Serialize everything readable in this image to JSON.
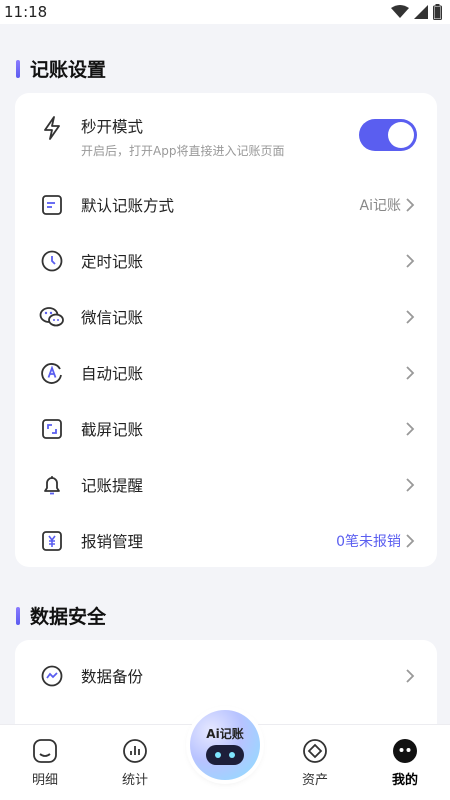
{
  "status": {
    "time": "11:18"
  },
  "sections": {
    "bookkeeping_title": "记账设置",
    "data_security_title": "数据安全"
  },
  "settings": {
    "quick_open": {
      "label": "秒开模式",
      "subtitle": "开启后，打开App将直接进入记账页面",
      "enabled": true
    },
    "default_method": {
      "label": "默认记账方式",
      "value": "Ai记账"
    },
    "scheduled": {
      "label": "定时记账"
    },
    "wechat": {
      "label": "微信记账"
    },
    "auto": {
      "label": "自动记账"
    },
    "screenshot": {
      "label": "截屏记账"
    },
    "reminder": {
      "label": "记账提醒"
    },
    "reimbursement": {
      "label": "报销管理",
      "value": "0笔未报销"
    }
  },
  "data_security": {
    "backup": {
      "label": "数据备份"
    }
  },
  "tabbar": {
    "details": "明细",
    "stats": "统计",
    "ai": "Ai记账",
    "assets": "资产",
    "mine": "我的"
  },
  "colors": {
    "accent": "#5a5ef0",
    "background": "#f3f4f8"
  }
}
